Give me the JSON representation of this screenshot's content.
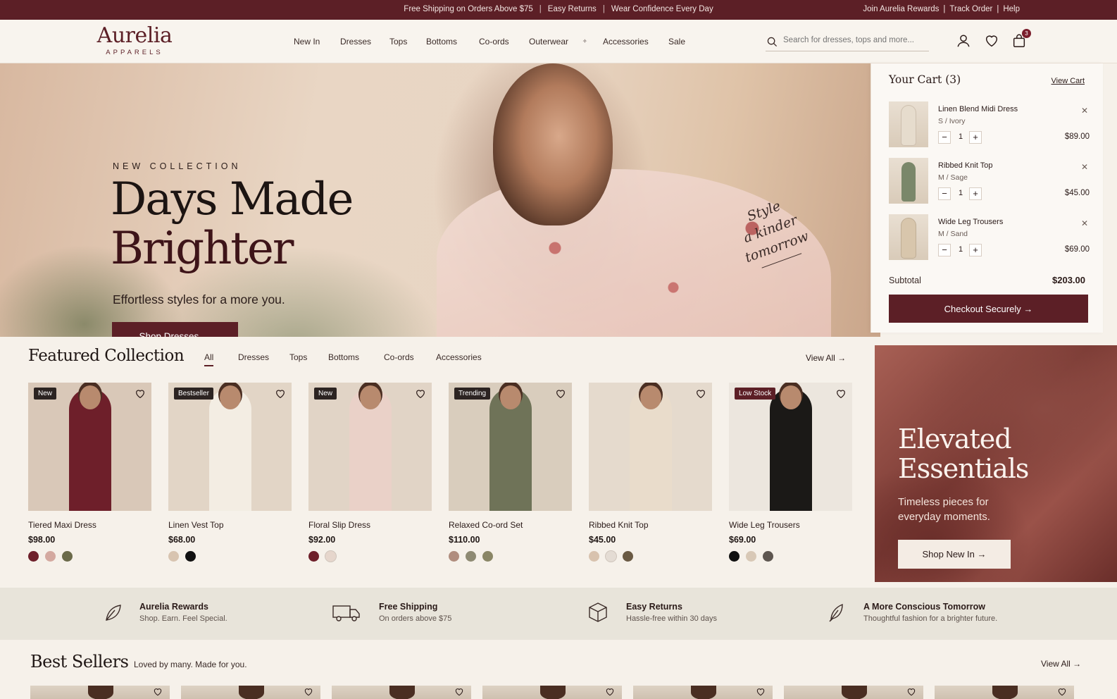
{
  "topbar": {
    "center": [
      "Free Shipping on Orders Above $75",
      "Easy Returns",
      "Wear Confidence Every Day"
    ],
    "right": [
      "Join Aurelia Rewards",
      "Track Order",
      "Help"
    ]
  },
  "brand": {
    "name": "Aurelia",
    "tagline": "APPARELS",
    "color": "#5c1f26"
  },
  "nav": [
    "New In",
    "Dresses",
    "Tops",
    "Bottoms",
    "Co-ords",
    "Outerwear",
    "Accessories",
    "Sale"
  ],
  "search": {
    "placeholder": "Search for dresses, tops and more..."
  },
  "header_icons": {
    "account": "user-icon",
    "wishlist": "heart-icon",
    "cart": "bag-icon",
    "cart_count": "3"
  },
  "hero": {
    "kicker": "NEW COLLECTION",
    "title_line1": "Days Made",
    "title_line2": "Brighter",
    "subtitle": "Effortless styles for a more you.",
    "cta": "Shop Dresses →",
    "script_l1": "Style",
    "script_l2": "a kinder",
    "script_l3": "tomorrow"
  },
  "cart": {
    "title": "Your Cart (3)",
    "view_cart": "View Cart",
    "items": [
      {
        "name": "Linen Blend Midi Dress",
        "variant": "S  /  Ivory",
        "qty": "1",
        "price": "$89.00",
        "color": "#e6dccd"
      },
      {
        "name": "Ribbed Knit Top",
        "variant": "M  /  Sage",
        "qty": "1",
        "price": "$45.00",
        "color": "#7a876a"
      },
      {
        "name": "Wide Leg Trousers",
        "variant": "M  /  Sand",
        "qty": "1",
        "price": "$69.00",
        "color": "#d8c6ac"
      }
    ],
    "subtotal_label": "Subtotal",
    "subtotal_value": "$203.00",
    "checkout": "Checkout Securely →"
  },
  "featured": {
    "title": "Featured Collection",
    "tabs": [
      "All",
      "Dresses",
      "Tops",
      "Bottoms",
      "Co-ords",
      "Accessories"
    ],
    "active_tab": "All",
    "view_all": "View All →",
    "products": [
      {
        "tag": "New",
        "name": "Tiered Maxi Dress",
        "price": "$98.00",
        "bg": "#d9c8b8",
        "garment": "#6e1f2a",
        "swatches": [
          "#6e1f2a",
          "#d4a9a0",
          "#6b6a4a"
        ]
      },
      {
        "tag": "Bestseller",
        "name": "Linen Vest Top",
        "price": "$68.00",
        "bg": "#e2d5c6",
        "garment": "#f3ede3",
        "swatches": [
          "#d8c4b0",
          "#111111"
        ]
      },
      {
        "tag": "New",
        "name": "Floral Slip Dress",
        "price": "$92.00",
        "bg": "#e1d4c6",
        "garment": "#ead1c8",
        "swatches": [
          "#6e1f2a",
          "#e6d6cc"
        ]
      },
      {
        "tag": "Trending",
        "name": "Relaxed Co-ord Set",
        "price": "$110.00",
        "bg": "#d9cdbd",
        "garment": "#6f7358",
        "swatches": [
          "#b08d7e",
          "#8e8a73",
          "#8a8666"
        ]
      },
      {
        "tag": "",
        "name": "Ribbed Knit Top",
        "price": "$45.00",
        "bg": "#e5dacd",
        "garment": "#e9dccb",
        "swatches": [
          "#d8c2ae",
          "#e4dcd4",
          "#6a5a44"
        ]
      },
      {
        "tag": "Low Stock",
        "name": "Wide Leg Trousers",
        "price": "$69.00",
        "bg": "#ece6de",
        "garment": "#1b1917",
        "swatches": [
          "#111111",
          "#d8c8b6",
          "#5e5650"
        ]
      }
    ]
  },
  "promo": {
    "title_l1": "Elevated",
    "title_l2": "Essentials",
    "text": "Timeless pieces for everyday moments.",
    "cta": "Shop New In →"
  },
  "benefits": [
    {
      "icon": "leaf-icon",
      "title": "Aurelia Rewards",
      "sub": "Shop. Earn. Feel Special."
    },
    {
      "icon": "truck-icon",
      "title": "Free Shipping",
      "sub": "On orders above $75"
    },
    {
      "icon": "box-icon",
      "title": "Easy Returns",
      "sub": "Hassle-free within 30 days"
    },
    {
      "icon": "feather-icon",
      "title": "A More Conscious Tomorrow",
      "sub": "Thoughtful fashion for a brighter future."
    }
  ],
  "best_sellers": {
    "title": "Best Sellers",
    "subtitle": "Loved by many. Made for you.",
    "view_all": "View All →",
    "count": 7
  }
}
